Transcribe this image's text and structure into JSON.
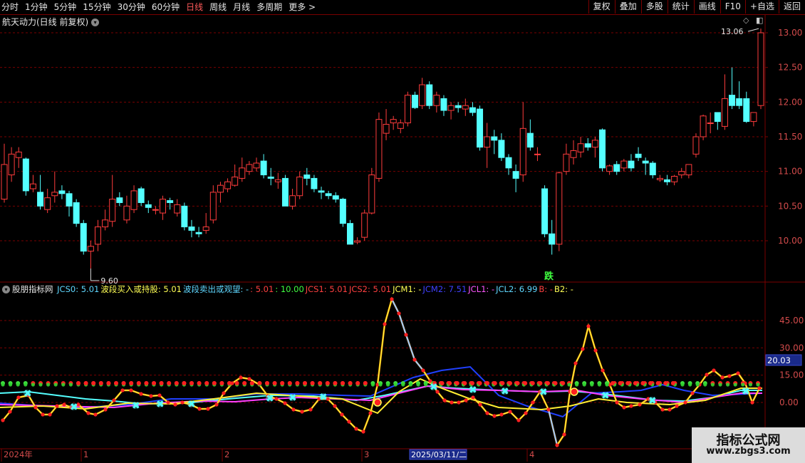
{
  "toolbar": {
    "left": [
      "分时",
      "1分钟",
      "5分钟",
      "15分钟",
      "30分钟",
      "60分钟",
      "日线",
      "周线",
      "月线",
      "多周期",
      "更多 >"
    ],
    "active": "日线",
    "right": [
      "复权",
      "叠加",
      "多股",
      "统计",
      "画线",
      "F10",
      "+自选",
      "返回"
    ]
  },
  "main_chart": {
    "title": "航天动力(日线 前复权)",
    "price_axis": [
      "13.00",
      "12.50",
      "12.00",
      "11.50",
      "11.00",
      "10.50",
      "10.00"
    ],
    "high_label": "13.06",
    "low_label": "9.60",
    "marker_label": "跌"
  },
  "indicator": {
    "name": "股朋指标网",
    "params": [
      {
        "text": "JCS0: 5.01",
        "color": "#5fd7ff"
      },
      {
        "text": "波段买入或持股: 5.01",
        "color": "#ffff55"
      },
      {
        "text": "波段卖出或观望: -",
        "color": "#5fd7ff"
      },
      {
        "text": ": 5.01",
        "color": "#ff4040"
      },
      {
        "text": ": 10.00",
        "color": "#40ff40"
      },
      {
        "text": "JCS1: 5.01",
        "color": "#ff4040"
      },
      {
        "text": "JCS2: 5.01",
        "color": "#ff4040"
      },
      {
        "text": "JCM1: -",
        "color": "#ffff55"
      },
      {
        "text": "JCM2: 7.51",
        "color": "#4040ff"
      },
      {
        "text": "JCL1: -",
        "color": "#ff55ff"
      },
      {
        "text": "JCL2: 6.99",
        "color": "#5fd7ff"
      },
      {
        "text": "B: -",
        "color": "#ff4040"
      },
      {
        "text": "B2: -",
        "color": "#ffff55"
      }
    ],
    "axis": [
      "45.00",
      "30.00",
      "15.00",
      "0.00"
    ],
    "current_value": "20.03"
  },
  "time_axis": {
    "labels": [
      "2024年",
      "1",
      "2",
      "3",
      "4"
    ],
    "cursor_date": "2025/03/11/二"
  },
  "watermark": {
    "line1": "指标公式网",
    "line2": "www.zbgs3.com"
  },
  "colors": {
    "up": "#ff3c3c",
    "down": "#54ffff",
    "grid": "#7a0000",
    "axis_text": "#d24b4b"
  },
  "chart_data": {
    "type": "candlestick",
    "title": "航天动力(日线 前复权)",
    "ylim": [
      9.5,
      13.2
    ],
    "candles": [
      {
        "o": 10.6,
        "h": 11.4,
        "l": 10.55,
        "c": 11.1
      },
      {
        "o": 10.95,
        "h": 11.35,
        "l": 10.85,
        "c": 11.25
      },
      {
        "o": 11.2,
        "h": 11.35,
        "l": 11.05,
        "c": 11.28
      },
      {
        "o": 11.18,
        "h": 11.2,
        "l": 10.65,
        "c": 10.72
      },
      {
        "o": 10.75,
        "h": 10.95,
        "l": 10.7,
        "c": 10.82
      },
      {
        "o": 10.7,
        "h": 10.95,
        "l": 10.45,
        "c": 10.5
      },
      {
        "o": 10.45,
        "h": 10.75,
        "l": 10.4,
        "c": 10.62
      },
      {
        "o": 10.65,
        "h": 11.0,
        "l": 10.55,
        "c": 10.7
      },
      {
        "o": 10.72,
        "h": 10.8,
        "l": 10.6,
        "c": 10.68
      },
      {
        "o": 10.68,
        "h": 10.72,
        "l": 10.35,
        "c": 10.5
      },
      {
        "o": 10.55,
        "h": 10.6,
        "l": 10.2,
        "c": 10.25
      },
      {
        "o": 10.25,
        "h": 10.3,
        "l": 9.8,
        "c": 9.85
      },
      {
        "o": 9.85,
        "h": 10.0,
        "l": 9.6,
        "c": 9.92
      },
      {
        "o": 9.95,
        "h": 10.3,
        "l": 9.85,
        "c": 10.2
      },
      {
        "o": 10.2,
        "h": 10.45,
        "l": 10.15,
        "c": 10.3
      },
      {
        "o": 10.28,
        "h": 10.95,
        "l": 10.2,
        "c": 10.6
      },
      {
        "o": 10.62,
        "h": 10.7,
        "l": 10.5,
        "c": 10.55
      },
      {
        "o": 10.3,
        "h": 10.65,
        "l": 10.25,
        "c": 10.5
      },
      {
        "o": 10.45,
        "h": 10.8,
        "l": 10.4,
        "c": 10.72
      },
      {
        "o": 10.75,
        "h": 10.78,
        "l": 10.5,
        "c": 10.55
      },
      {
        "o": 10.52,
        "h": 10.58,
        "l": 10.4,
        "c": 10.48
      },
      {
        "o": 10.45,
        "h": 10.5,
        "l": 10.38,
        "c": 10.45
      },
      {
        "o": 10.4,
        "h": 10.65,
        "l": 10.3,
        "c": 10.6
      },
      {
        "o": 10.58,
        "h": 10.62,
        "l": 10.45,
        "c": 10.55
      },
      {
        "o": 10.4,
        "h": 10.6,
        "l": 10.35,
        "c": 10.52
      },
      {
        "o": 10.5,
        "h": 10.55,
        "l": 10.15,
        "c": 10.2
      },
      {
        "o": 10.2,
        "h": 10.3,
        "l": 10.05,
        "c": 10.15
      },
      {
        "o": 10.12,
        "h": 10.2,
        "l": 10.05,
        "c": 10.1
      },
      {
        "o": 10.15,
        "h": 10.4,
        "l": 10.1,
        "c": 10.2
      },
      {
        "o": 10.3,
        "h": 10.8,
        "l": 10.25,
        "c": 10.7
      },
      {
        "o": 10.7,
        "h": 10.85,
        "l": 10.55,
        "c": 10.8
      },
      {
        "o": 10.75,
        "h": 10.9,
        "l": 10.7,
        "c": 10.85
      },
      {
        "o": 10.8,
        "h": 11.1,
        "l": 10.78,
        "c": 10.92
      },
      {
        "o": 10.9,
        "h": 11.2,
        "l": 10.85,
        "c": 11.05
      },
      {
        "o": 11.0,
        "h": 11.15,
        "l": 10.95,
        "c": 11.1
      },
      {
        "o": 11.05,
        "h": 11.2,
        "l": 11.0,
        "c": 11.12
      },
      {
        "o": 11.15,
        "h": 11.25,
        "l": 10.9,
        "c": 10.95
      },
      {
        "o": 10.92,
        "h": 11.05,
        "l": 10.8,
        "c": 10.9
      },
      {
        "o": 10.85,
        "h": 10.98,
        "l": 10.75,
        "c": 10.88
      },
      {
        "o": 10.9,
        "h": 10.95,
        "l": 10.5,
        "c": 10.5
      },
      {
        "o": 10.5,
        "h": 10.75,
        "l": 10.45,
        "c": 10.65
      },
      {
        "o": 10.65,
        "h": 11.0,
        "l": 10.6,
        "c": 10.92
      },
      {
        "o": 10.95,
        "h": 11.05,
        "l": 10.8,
        "c": 10.9
      },
      {
        "o": 10.9,
        "h": 10.95,
        "l": 10.7,
        "c": 10.75
      },
      {
        "o": 10.72,
        "h": 10.78,
        "l": 10.6,
        "c": 10.7
      },
      {
        "o": 10.68,
        "h": 10.72,
        "l": 10.6,
        "c": 10.65
      },
      {
        "o": 10.65,
        "h": 10.7,
        "l": 10.55,
        "c": 10.6
      },
      {
        "o": 10.6,
        "h": 10.62,
        "l": 10.2,
        "c": 10.25
      },
      {
        "o": 10.25,
        "h": 10.3,
        "l": 9.95,
        "c": 9.95
      },
      {
        "o": 9.98,
        "h": 10.05,
        "l": 9.95,
        "c": 10.0
      },
      {
        "o": 10.05,
        "h": 10.45,
        "l": 10.0,
        "c": 10.4
      },
      {
        "o": 10.4,
        "h": 11.05,
        "l": 10.38,
        "c": 10.95
      },
      {
        "o": 10.9,
        "h": 11.85,
        "l": 10.85,
        "c": 11.75
      },
      {
        "o": 11.55,
        "h": 11.9,
        "l": 11.45,
        "c": 11.68
      },
      {
        "o": 11.7,
        "h": 11.8,
        "l": 11.6,
        "c": 11.75
      },
      {
        "o": 11.62,
        "h": 11.75,
        "l": 11.55,
        "c": 11.7
      },
      {
        "o": 11.7,
        "h": 12.15,
        "l": 11.65,
        "c": 12.1
      },
      {
        "o": 12.1,
        "h": 12.15,
        "l": 11.9,
        "c": 11.92
      },
      {
        "o": 11.95,
        "h": 12.35,
        "l": 11.9,
        "c": 12.25
      },
      {
        "o": 12.25,
        "h": 12.3,
        "l": 11.9,
        "c": 11.95
      },
      {
        "o": 11.95,
        "h": 12.15,
        "l": 11.85,
        "c": 12.1
      },
      {
        "o": 12.05,
        "h": 12.1,
        "l": 11.8,
        "c": 11.88
      },
      {
        "o": 11.88,
        "h": 12.0,
        "l": 11.75,
        "c": 11.95
      },
      {
        "o": 11.95,
        "h": 12.0,
        "l": 11.85,
        "c": 11.92
      },
      {
        "o": 11.9,
        "h": 12.05,
        "l": 11.8,
        "c": 11.95
      },
      {
        "o": 11.92,
        "h": 12.0,
        "l": 11.8,
        "c": 11.85
      },
      {
        "o": 11.9,
        "h": 11.95,
        "l": 11.3,
        "c": 11.35
      },
      {
        "o": 11.35,
        "h": 11.7,
        "l": 11.05,
        "c": 11.5
      },
      {
        "o": 11.5,
        "h": 11.6,
        "l": 11.25,
        "c": 11.45
      },
      {
        "o": 11.45,
        "h": 11.55,
        "l": 11.15,
        "c": 11.2
      },
      {
        "o": 11.2,
        "h": 11.25,
        "l": 10.95,
        "c": 11.05
      },
      {
        "o": 11.0,
        "h": 11.1,
        "l": 10.7,
        "c": 10.9
      },
      {
        "o": 10.95,
        "h": 12.0,
        "l": 10.85,
        "c": 11.62
      },
      {
        "o": 11.55,
        "h": 11.75,
        "l": 11.3,
        "c": 11.35
      },
      {
        "o": 11.25,
        "h": 11.35,
        "l": 11.15,
        "c": 11.25
      },
      {
        "o": 10.75,
        "h": 10.8,
        "l": 10.05,
        "c": 10.1
      },
      {
        "o": 10.1,
        "h": 10.3,
        "l": 9.8,
        "c": 9.95
      },
      {
        "o": 9.95,
        "h": 11.0,
        "l": 9.85,
        "c": 10.98
      },
      {
        "o": 11.0,
        "h": 11.4,
        "l": 10.95,
        "c": 11.25
      },
      {
        "o": 11.2,
        "h": 11.45,
        "l": 11.1,
        "c": 11.3
      },
      {
        "o": 11.28,
        "h": 11.5,
        "l": 11.2,
        "c": 11.4
      },
      {
        "o": 11.4,
        "h": 11.48,
        "l": 11.3,
        "c": 11.35
      },
      {
        "o": 11.35,
        "h": 11.5,
        "l": 11.2,
        "c": 11.45
      },
      {
        "o": 11.6,
        "h": 11.62,
        "l": 11.0,
        "c": 11.05
      },
      {
        "o": 11.0,
        "h": 11.1,
        "l": 10.95,
        "c": 11.08
      },
      {
        "o": 11.1,
        "h": 11.15,
        "l": 10.95,
        "c": 11.0
      },
      {
        "o": 11.05,
        "h": 11.18,
        "l": 11.0,
        "c": 11.15
      },
      {
        "o": 11.15,
        "h": 11.25,
        "l": 11.0,
        "c": 11.05
      },
      {
        "o": 11.25,
        "h": 11.35,
        "l": 11.15,
        "c": 11.2
      },
      {
        "o": 11.15,
        "h": 11.2,
        "l": 10.95,
        "c": 11.12
      },
      {
        "o": 11.12,
        "h": 11.15,
        "l": 10.9,
        "c": 10.95
      },
      {
        "o": 10.88,
        "h": 10.95,
        "l": 10.85,
        "c": 10.9
      },
      {
        "o": 10.88,
        "h": 10.95,
        "l": 10.8,
        "c": 10.85
      },
      {
        "o": 10.85,
        "h": 10.95,
        "l": 10.8,
        "c": 10.93
      },
      {
        "o": 10.95,
        "h": 11.05,
        "l": 10.9,
        "c": 11.0
      },
      {
        "o": 10.95,
        "h": 11.1,
        "l": 10.9,
        "c": 11.1
      },
      {
        "o": 11.25,
        "h": 11.55,
        "l": 11.2,
        "c": 11.5
      },
      {
        "o": 11.5,
        "h": 11.82,
        "l": 11.45,
        "c": 11.8
      },
      {
        "o": 11.7,
        "h": 11.85,
        "l": 11.55,
        "c": 11.7
      },
      {
        "o": 11.85,
        "h": 11.8,
        "l": 11.6,
        "c": 11.72
      },
      {
        "o": 11.65,
        "h": 12.4,
        "l": 11.6,
        "c": 12.05
      },
      {
        "o": 12.1,
        "h": 12.5,
        "l": 11.9,
        "c": 11.95
      },
      {
        "o": 12.05,
        "h": 12.3,
        "l": 11.9,
        "c": 11.95
      },
      {
        "o": 12.05,
        "h": 12.15,
        "l": 11.7,
        "c": 11.72
      },
      {
        "o": 11.72,
        "h": 11.85,
        "l": 11.65,
        "c": 11.85
      },
      {
        "o": 11.95,
        "h": 13.06,
        "l": 11.9,
        "c": 13.0
      }
    ]
  }
}
